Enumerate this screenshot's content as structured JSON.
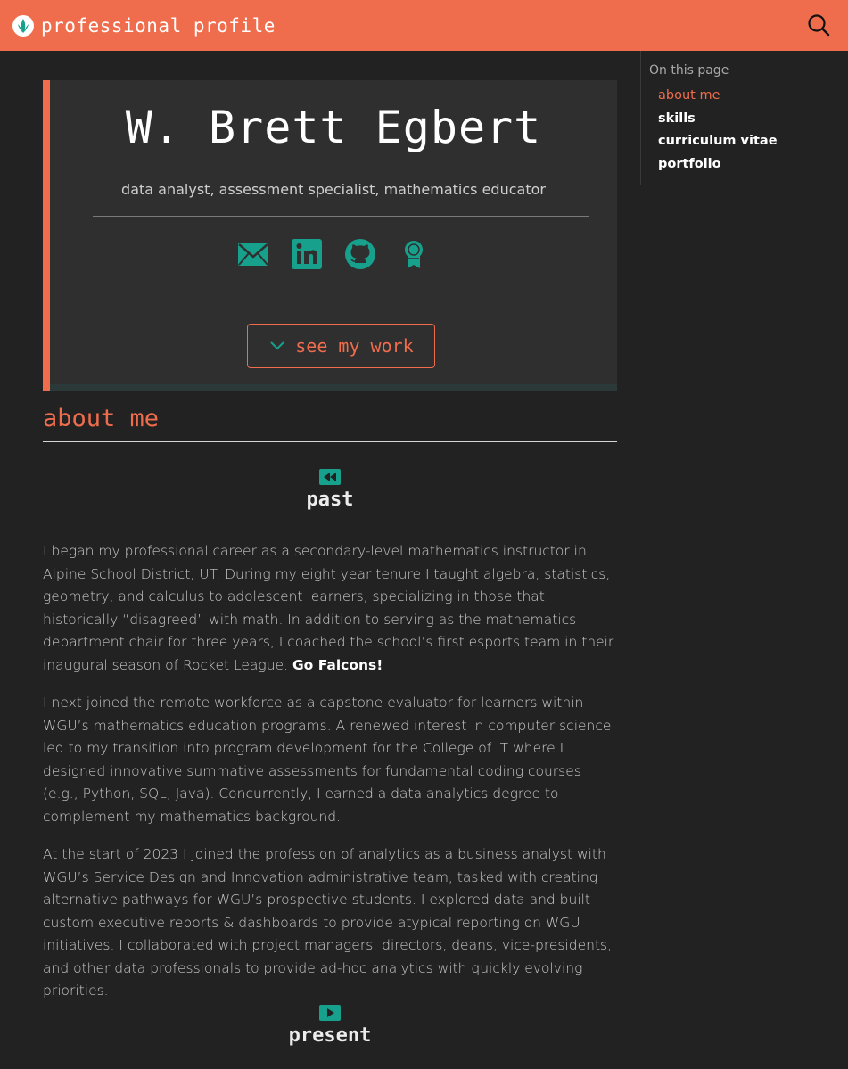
{
  "header": {
    "site_title": "professional profile"
  },
  "hero": {
    "name": "W. Brett Egbert",
    "subtitle": "data analyst, assessment specialist, mathematics educator",
    "cta_label": "see my work"
  },
  "about": {
    "title": "about me",
    "past_heading": "past",
    "paragraphs": [
      "I began my professional career as a secondary-level mathematics instructor in Alpine School District, UT. During my eight year tenure I taught algebra, statistics, geometry, and calculus to adolescent learners, specializing in those that historically “disagreed” with math. In addition to serving as the mathematics department chair for three years, I coached the school’s first esports team in their inaugural season of Rocket League. ",
      "I next joined the remote workforce as a capstone evaluator for learners within WGU’s mathematics education programs. A renewed interest in computer science led to my transition into program development for the College of IT where I designed innovative summative assessments for fundamental coding courses (e.g., Python, SQL, Java). Concurrently, I earned a data analytics degree to complement my mathematics background.",
      "At the start of 2023 I joined the profession of analytics as a business analyst with WGU’s Service Design and Innovation administrative team, tasked with creating alternative pathways for WGU’s prospective students. I explored data and built custom executive reports & dashboards to provide atypical reporting on WGU initiatives. I collaborated with project managers, directors, deans, vice-presidents, and other data professionals to provide ad-hoc analytics with quickly evolving priorities."
    ],
    "emphasis": "Go Falcons!",
    "present_heading": "present"
  },
  "toc": {
    "label": "On this page",
    "items": [
      {
        "label": "about me"
      },
      {
        "label": "skills"
      },
      {
        "label": "curriculum vitae"
      },
      {
        "label": "portfolio"
      }
    ]
  },
  "colors": {
    "accent": "#ef6c4d",
    "teal": "#17a08c",
    "background": "#222222"
  }
}
